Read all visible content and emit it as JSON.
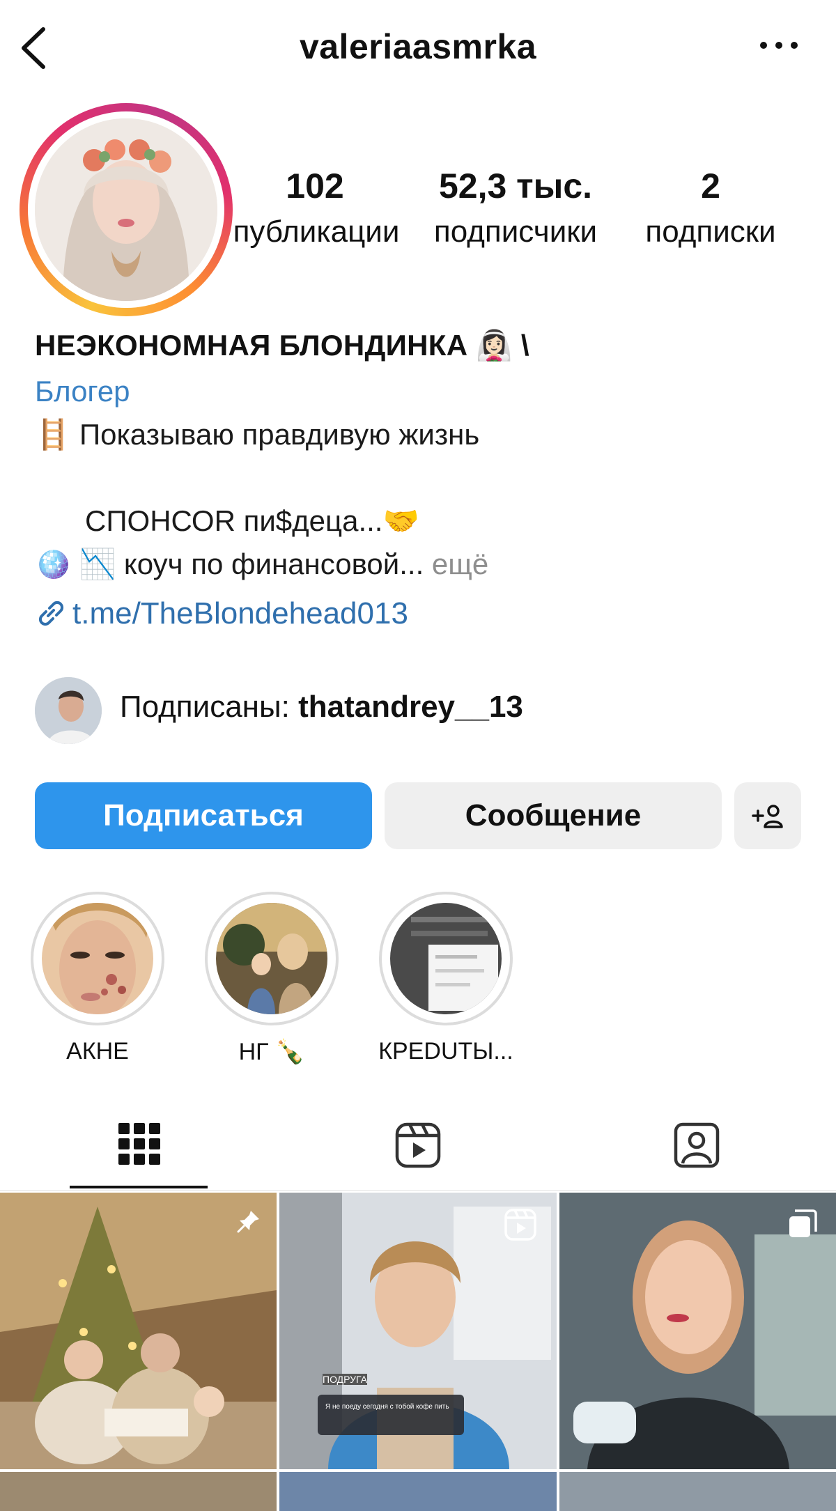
{
  "header": {
    "username": "valeriaasmrka",
    "back_icon": "chevron-left-icon",
    "more_icon": "more-horizontal-icon"
  },
  "stats": {
    "posts": {
      "value": "102",
      "label": "публикации"
    },
    "followers": {
      "value": "52,3 тыс.",
      "label": "подписчики"
    },
    "following": {
      "value": "2",
      "label": "подписки"
    }
  },
  "bio": {
    "name": "НЕЭКОНОМНАЯ БЛОНДИНКА 👰🏻‍♀️ \\",
    "category": "Блогер",
    "line1": "🪜 Показываю правдивую жизнь",
    "line2": "СПОНСОR пи$деца...🤝",
    "line3": "🪩 📉 коуч по финансовой...",
    "more": "ещё",
    "link": "t.me/TheBlondehead013"
  },
  "followed_by": {
    "prefix": "Подписаны: ",
    "username": "thatandrey__13"
  },
  "actions": {
    "follow": "Подписаться",
    "message": "Сообщение",
    "add_icon": "add-person-icon"
  },
  "highlights": [
    {
      "label": "АКНЕ"
    },
    {
      "label": "НГ 🍾"
    },
    {
      "label": "КРЕDUТЫ..."
    }
  ],
  "tabs": {
    "active": "grid",
    "icons": [
      "grid-icon",
      "reels-icon",
      "tagged-icon"
    ]
  },
  "posts": [
    {
      "badge": "pinned-icon",
      "caption_title": "",
      "caption_text": ""
    },
    {
      "badge": "reel-icon",
      "caption_title": "ПОДРУГА",
      "caption_text": "Я не поеду сегодня с тобой кофе пить"
    },
    {
      "badge": "carousel-icon",
      "caption_title": "",
      "caption_text": ""
    }
  ]
}
